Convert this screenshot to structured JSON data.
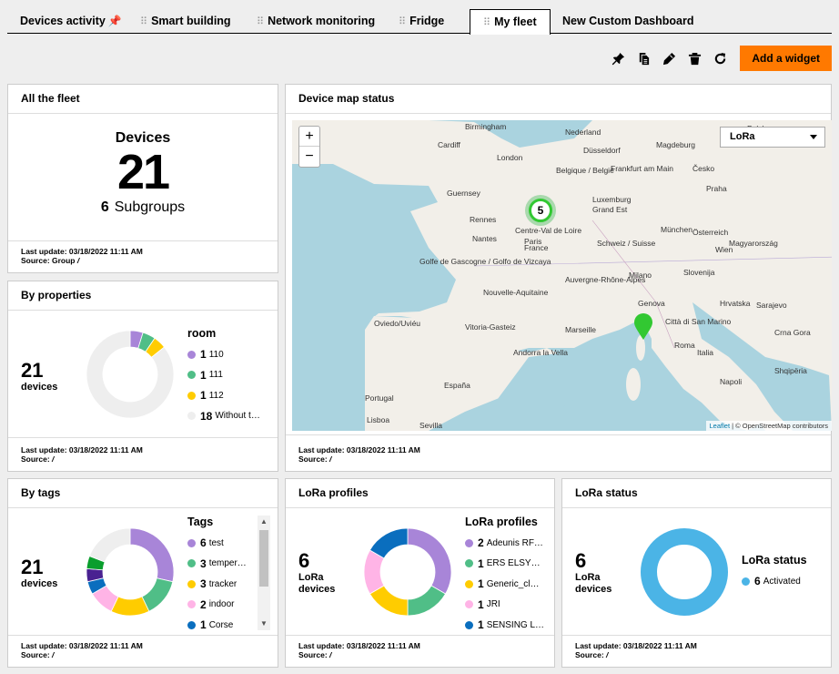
{
  "tabs": [
    {
      "label": "Devices activity",
      "pinned": true
    },
    {
      "label": "Smart building"
    },
    {
      "label": "Network monitoring"
    },
    {
      "label": "Fridge"
    },
    {
      "label": "My fleet",
      "active": true
    },
    {
      "label": "New Custom Dashboard"
    }
  ],
  "toolbar": {
    "icons": [
      "pin-icon",
      "copy-icon",
      "edit-icon",
      "trash-icon",
      "refresh-icon"
    ],
    "add_label": "Add a widget",
    "accent": "#ff7900"
  },
  "fleet": {
    "title": "All the fleet",
    "label": "Devices",
    "count": "21",
    "subgroups_count": "6",
    "subgroups_label": "Subgroups",
    "update": "Last update: 03/18/2022 11:11 AM",
    "source": "Source: Group",
    "source_link": "/"
  },
  "properties": {
    "title": "By properties",
    "count": "21",
    "count_label": "devices",
    "legend_title": "room",
    "items": [
      {
        "num": "1",
        "label": "110",
        "color": "#a885d8"
      },
      {
        "num": "1",
        "label": "111",
        "color": "#50be87"
      },
      {
        "num": "1",
        "label": "112",
        "color": "#ffcc00"
      },
      {
        "num": "18",
        "label": "Without t…",
        "color": "#eeeeee"
      }
    ],
    "values": [
      1,
      1,
      1,
      18
    ],
    "update": "Last update: 03/18/2022 11:11 AM",
    "source": "Source:",
    "source_link": "/"
  },
  "map": {
    "title": "Device map status",
    "select_value": "LoRa",
    "zoom_in": "+",
    "zoom_out": "−",
    "cluster_count": "5",
    "attribution_leaflet": "Leaflet",
    "attribution_osm": " | © OpenStreetMap contributors",
    "cities": [
      "Birmingham",
      "Cardiff",
      "London",
      "Nederland",
      "Düsseldorf",
      "Magdeburg",
      "Polska",
      "Guernsey",
      "Belgique / België",
      "Frankfurt am Main",
      "Česko",
      "Rennes",
      "Paris",
      "Luxemburg",
      "Praha",
      "Nantes",
      "Centre-Val de Loire",
      "France",
      "Grand Est",
      "München",
      "Österreich",
      "Golfe de Gascogne / Golfo de Vizcaya",
      "Nouvelle-Aquitaine",
      "Auvergne-Rhône-Alpes",
      "Schweiz / Suisse",
      "Wien",
      "Magyarország",
      "Slovenija",
      "Milano",
      "Hrvatska",
      "Genova",
      "Sarajevo",
      "Oviedo/Uviéu",
      "Marseille",
      "Roma",
      "Città di San Marino",
      "Crna Gora",
      "Vitoria-Gasteiz",
      "Andorra la Vella",
      "Portugal",
      "España",
      "Lisboa",
      "Sevilla",
      "Italia",
      "Shqipëria",
      "Napoli"
    ],
    "update": "Last update: 03/18/2022 11:11 AM",
    "source": "Source:",
    "source_link": "/"
  },
  "tags": {
    "title": "By tags",
    "count": "21",
    "count_label": "devices",
    "legend_title": "Tags",
    "items": [
      {
        "num": "6",
        "label": "test",
        "color": "#a885d8"
      },
      {
        "num": "3",
        "label": "temper…",
        "color": "#50be87"
      },
      {
        "num": "3",
        "label": "tracker",
        "color": "#ffcc00"
      },
      {
        "num": "2",
        "label": "indoor",
        "color": "#ffb4e6"
      },
      {
        "num": "1",
        "label": "Corse",
        "color": "#0a6ebe"
      }
    ],
    "extra_colors": [
      "#492191",
      "#0a9e2d",
      "#eeeeee"
    ],
    "values": [
      6,
      3,
      3,
      2,
      1,
      1,
      1,
      4
    ],
    "scroll_up": "▲",
    "scroll_down": "▼",
    "update": "Last update: 03/18/2022 11:11 AM",
    "source": "Source:",
    "source_link": "/"
  },
  "lora_profiles": {
    "title": "LoRa profiles",
    "count": "6",
    "count_label_1": "LoRa",
    "count_label_2": "devices",
    "legend_title": "LoRa profiles",
    "items": [
      {
        "num": "2",
        "label": "Adeunis RF…",
        "color": "#a885d8"
      },
      {
        "num": "1",
        "label": "ERS ELSY…",
        "color": "#50be87"
      },
      {
        "num": "1",
        "label": "Generic_cl…",
        "color": "#ffcc00"
      },
      {
        "num": "1",
        "label": "JRI",
        "color": "#ffb4e6"
      },
      {
        "num": "1",
        "label": "SENSING L…",
        "color": "#0a6ebe"
      }
    ],
    "values": [
      2,
      1,
      1,
      1,
      1
    ],
    "update": "Last update: 03/18/2022 11:11 AM",
    "source": "Source:",
    "source_link": "/"
  },
  "lora_status": {
    "title": "LoRa status",
    "count": "6",
    "count_label_1": "LoRa",
    "count_label_2": "devices",
    "legend_title": "LoRa status",
    "items": [
      {
        "num": "6",
        "label": "Activated",
        "color": "#4bb4e6"
      }
    ],
    "values": [
      6
    ],
    "update": "Last update: 03/18/2022 11:11 AM",
    "source": "Source:",
    "source_link": "/"
  }
}
